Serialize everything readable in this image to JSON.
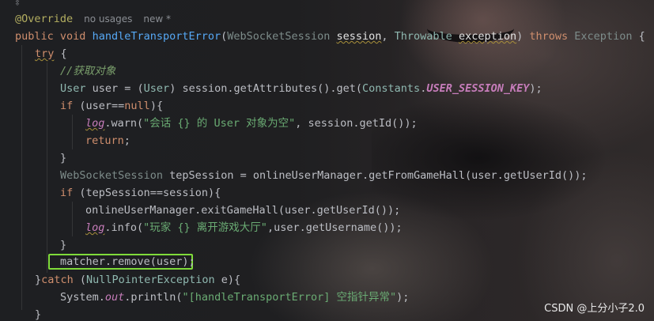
{
  "editor": {
    "line_annotation": "@Override",
    "usages_hint": "no usages",
    "new_hint": "new *",
    "lines": {
      "l1": {
        "kw1": "public",
        "kw2": "void",
        "fn": "handleTransportError",
        "p1": "(",
        "t1": "WebSocketSession",
        "param1": "session",
        "comma": ", ",
        "t2": "Throwable",
        "param2": "exception",
        "p2": ")",
        "kw3": "throws",
        "t3": "Exception",
        "brace": "{"
      },
      "l2": {
        "kw": "try",
        "rest": " {"
      },
      "l3": {
        "comment": "//获取对象"
      },
      "l4": {
        "t": "User",
        "a": " user = (",
        "t2": "User",
        "b": ") session.getAttributes().get(",
        "t3": "Constants",
        "dot": ".",
        "sf": "USER_SESSION_KEY",
        "c": ");"
      },
      "l5": {
        "kw": "if",
        "a": " (user==",
        "kw2": "null",
        "b": "){"
      },
      "l6": {
        "f": "log",
        "a": ".warn(",
        "s": "\"会话 {} 的 User 对象为空\"",
        "b": ", session.getId());"
      },
      "l7": {
        "kw": "return",
        "a": ";"
      },
      "l8": {
        "a": "}"
      },
      "l9": {
        "t": "WebSocketSession",
        "a": " tepSession = onlineUserManager.getFromGameHall(user.getUserId());"
      },
      "l10": {
        "kw": "if",
        "a": " (tepSession==session){"
      },
      "l11": {
        "a": "onlineUserManager.exitGameHall(user.getUserId());"
      },
      "l12": {
        "f": "log",
        "a": ".info(",
        "s": "\"玩家 {} 离开游戏大厅\"",
        "b": ",user.getUsername());"
      },
      "l13": {
        "a": "}"
      },
      "l14": {
        "a": "matcher.remove(user);"
      },
      "l15": {
        "a": "}",
        "kw": "catch",
        "b": " (",
        "t": "NullPointerException",
        "c": " e){"
      },
      "l16": {
        "a": "System.",
        "f": "out",
        "b": ".println(",
        "s": "\"[handleTransportError] 空指针异常\"",
        "c": ");"
      },
      "l17": {
        "a": "}"
      }
    }
  },
  "watermark": "CSDN @上分小子2.0",
  "colors": {
    "keyword": "#cf8e6d",
    "method": "#56a8f5",
    "string": "#6aab73",
    "comment": "#7a9f6c",
    "annotation": "#b3ae60",
    "static_field": "#c77dbb",
    "highlight_box": "#7fdb3a"
  },
  "icons": {
    "gutter": "fold-icon"
  }
}
